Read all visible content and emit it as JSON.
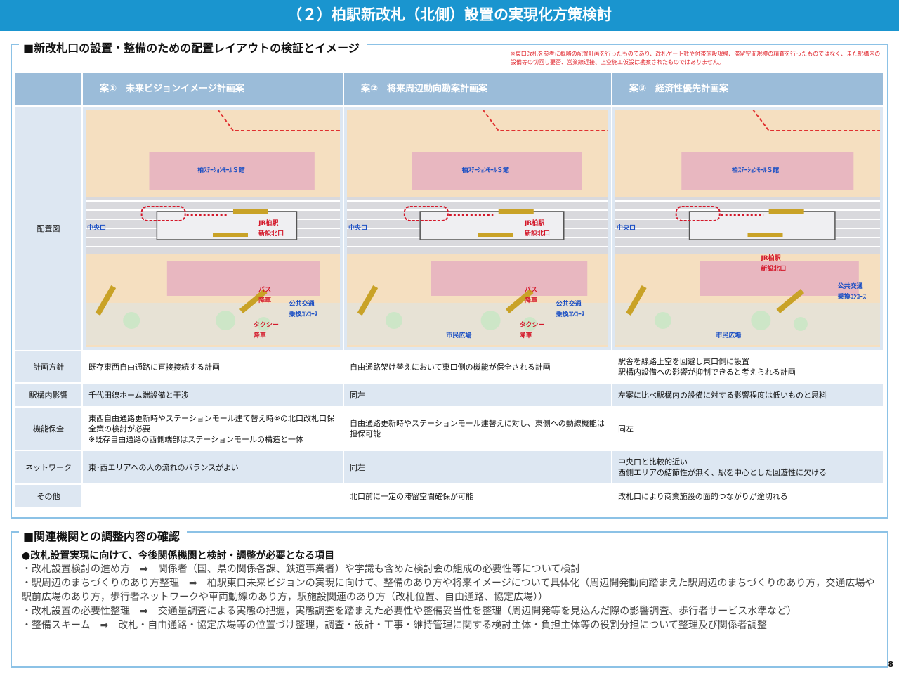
{
  "header": {
    "title": "（２）柏駅新改札（北側）設置の実現化方策検討"
  },
  "layout_section": {
    "title": "■新改札口の設置・整備のための配置レイアウトの検証とイメージ",
    "note": "※東口改札を参考に概略の配置計画を行ったものであり、改札ゲート数や付帯施設規模、滞留空間規模の精査を行ったものではなく、また駅構内の設備等の切回し要否、営業線近接、上空施工仮設は勘案されたものではありません。",
    "columns": [
      "案①　未来ビジョンイメージ計画案",
      "案②　将来周辺動向勘案計画案",
      "案③　経済性優先計画案"
    ],
    "map_row_label": "配置図",
    "maps": [
      {
        "mall": "柏ｽﾃｰｼｮﾝﾓｰﾙＳ館",
        "central": "中央口",
        "gate": "JR柏駅\n新設北口",
        "transit": "公共交通\n乗換ｺﾝｺｰｽ",
        "plaza": "",
        "bus": "バス\n降車",
        "taxi": "タクシー\n降車"
      },
      {
        "mall": "柏ｽﾃｰｼｮﾝﾓｰﾙＳ館",
        "central": "中央口",
        "gate": "JR柏駅\n新設北口",
        "transit": "公共交通\n乗換ｺﾝｺｰｽ",
        "plaza": "市民広場",
        "bus": "バス\n降車",
        "taxi": "タクシー\n降車"
      },
      {
        "mall": "柏ｽﾃｰｼｮﾝﾓｰﾙＳ館",
        "central": "中央口",
        "gate": "JR柏駅\n新設北口",
        "transit": "公共交通\n乗換ｺﾝｺｰｽ",
        "plaza": "市民広場",
        "bus": "",
        "taxi": ""
      }
    ],
    "rows": [
      {
        "label": "計画方針",
        "cells": [
          "既存東西自由通路に直接接続する計画",
          "自由通路架け替えにおいて東口側の機能が保全される計画",
          "駅舎を線路上空を回避し東口側に設置\n駅構内設備への影響が抑制できると考えられる計画"
        ]
      },
      {
        "label": "駅構内影響",
        "cells": [
          "千代田線ホーム端設備と干渉",
          "同左",
          "左案に比べ駅構内の設備に対する影響程度は低いものと思料"
        ]
      },
      {
        "label": "機能保全",
        "cells": [
          "東西自由通路更新時やステーションモール建て替え時※の北口改札口保全策の検討が必要\n※既存自由通路の西側端部はステーションモールの構造と一体",
          "自由通路更新時やステーションモール建替えに対し、東側への動線機能は担保可能",
          "同左"
        ]
      },
      {
        "label": "ネットワーク",
        "cells": [
          "東･西エリアへの人の流れのバランスがよい",
          "同左",
          "中央口と比較的近い\n西側エリアの結節性が無く、駅を中心とした回遊性に欠ける"
        ]
      },
      {
        "label": "その他",
        "cells": [
          "",
          "北口前に一定の滞留空間確保が可能",
          "改札口により商業施設の面的つながりが途切れる"
        ]
      }
    ]
  },
  "coordination_section": {
    "title": "■関連機関との調整内容の確認",
    "headline": "●改札設置実現に向けて、今後関係機関と検討・調整が必要となる項目",
    "items": [
      "・改札設置検討の進め方　➡　関係者（国、県の関係各課、鉄道事業者）や学識も含めた検討会の組成の必要性等について検討",
      "・駅周辺のまちづくりのあり方整理　➡　柏駅東口未来ビジョンの実現に向けて、整備のあり方や将来イメージについて具体化（周辺開発動向踏まえた駅周辺のまちづくりのあり方，交通広場や駅前広場のあり方，歩行者ネットワークや車両動線のあり方，駅施設関連のあり方（改札位置、自由通路、協定広場））",
      "・改札設置の必要性整理　➡　交通量調査による実態の把握，実態調査を踏まえた必要性や整備妥当性を整理（周辺開発等を見込んだ際の影響調査、歩行者サービス水準など）",
      "・整備スキーム　➡　改札・自由通路・協定広場等の位置づけ整理，調査・設計・工事・維持管理に関する検討主体・負担主体等の役割分担について整理及び関係者調整"
    ]
  },
  "page_number": "8",
  "colors": {
    "title_bar": "#1a95cf",
    "header_cell": "#9bbcd9",
    "row_alt": "#dde7f2",
    "panel_border": "#8cc2e6",
    "note_red": "#e0262d"
  }
}
